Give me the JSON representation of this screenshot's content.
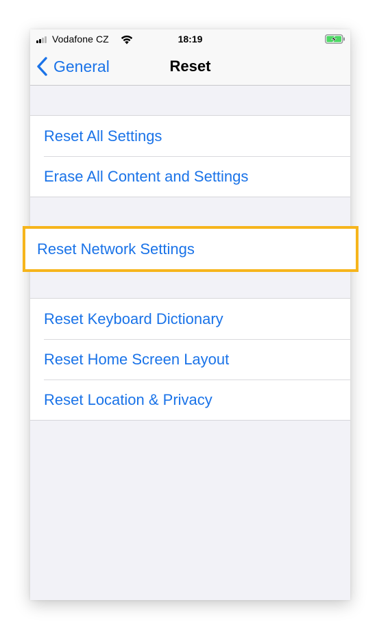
{
  "status_bar": {
    "carrier": "Vodafone CZ",
    "time": "18:19",
    "signal_icon": "cellular-signal-icon",
    "wifi_icon": "wifi-icon",
    "battery_icon": "battery-charging-icon"
  },
  "nav": {
    "back_label": "General",
    "title": "Reset",
    "back_icon": "chevron-left-icon"
  },
  "groups": [
    {
      "items": [
        "Reset All Settings",
        "Erase All Content and Settings"
      ]
    },
    {
      "items": [
        "Reset Network Settings"
      ],
      "highlighted": true
    },
    {
      "items": [
        "Reset Keyboard Dictionary",
        "Reset Home Screen Layout",
        "Reset Location & Privacy"
      ]
    }
  ],
  "colors": {
    "accent": "#1a73e8",
    "highlight_border": "#f6b51c",
    "background": "#f2f2f7",
    "battery_green": "#4cd964"
  }
}
